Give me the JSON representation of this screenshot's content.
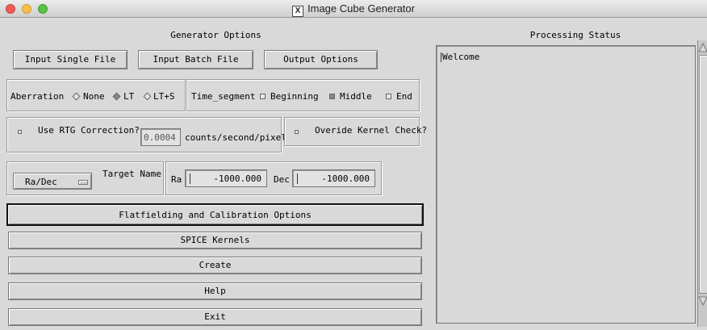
{
  "window": {
    "title": "Image Cube Generator"
  },
  "generator": {
    "heading": "Generator Options",
    "buttons": [
      "Input Single File",
      "Input Batch File",
      "Output Options"
    ],
    "aberration": {
      "label": "Aberration",
      "options": [
        "None",
        "LT",
        "LT+S"
      ],
      "selected": "LT"
    },
    "time_segment": {
      "label": "Time_segment",
      "options": [
        "Beginning",
        "Middle",
        "End"
      ],
      "checked": [
        "Middle"
      ]
    },
    "rtg": {
      "label": "Use RTG Correction?",
      "value": "0.0004",
      "units": "counts/second/pixel"
    },
    "kernel_check": {
      "label": "Overide Kernel Check?"
    },
    "target": {
      "coord_select": "Ra/Dec",
      "label": "Target Name",
      "ra_label": "Ra",
      "ra_value": "-1000.000",
      "dec_label": "Dec",
      "dec_value": "-1000.000"
    },
    "actions": [
      "Flatfielding and Calibration Options",
      "SPICE Kernels",
      "Create",
      "Help",
      "Exit"
    ]
  },
  "status": {
    "heading": "Processing Status",
    "text": "Welcome"
  }
}
